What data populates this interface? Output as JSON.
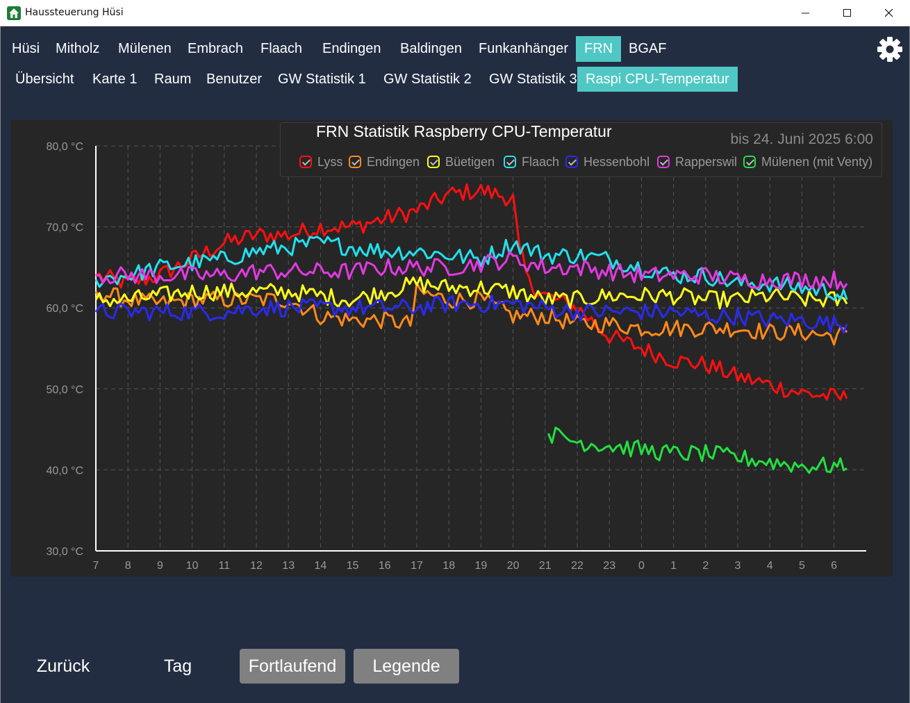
{
  "window": {
    "title": "Haussteuerung Hüsi"
  },
  "nav_top": [
    "Hüsi",
    "Mitholz",
    "Mülenen",
    "Embrach",
    "Flaach",
    "Endingen",
    "Baldingen",
    "Funkanhänger",
    "FRN",
    "BGAF"
  ],
  "nav_top_active": "FRN",
  "nav_sub": [
    "Übersicht",
    "Karte 1",
    "Raum",
    "Benutzer",
    "GW Statistik 1",
    "GW Statistik 2",
    "GW Statistik 3",
    "Raspi CPU-Temperatur"
  ],
  "nav_sub_active": "Raspi CPU-Temperatur",
  "chart_header": {
    "title": "FRN Statistik Raspberry CPU-Temperatur",
    "date": "bis 24. Juni 2025 6:00"
  },
  "bottom": {
    "back": "Zurück",
    "day": "Tag",
    "continuous": "Fortlaufend",
    "legend": "Legende"
  },
  "chart_data": {
    "type": "line",
    "title": "FRN Statistik Raspberry CPU-Temperatur",
    "ylim": [
      30,
      80
    ],
    "yticks": [
      "30,0 °C",
      "40,0 °C",
      "50,0 °C",
      "60,0 °C",
      "70,0 °C",
      "80,0 °C"
    ],
    "xticks": [
      "7",
      "8",
      "9",
      "10",
      "11",
      "12",
      "13",
      "14",
      "15",
      "16",
      "17",
      "18",
      "19",
      "20",
      "21",
      "22",
      "23",
      "0",
      "1",
      "2",
      "3",
      "4",
      "5",
      "6"
    ],
    "xlim": [
      7,
      31
    ],
    "grid": true,
    "legend_position": "top",
    "series": [
      {
        "name": "Lyss",
        "color": "#ff1010",
        "points": [
          [
            7,
            64
          ],
          [
            8,
            63
          ],
          [
            9,
            64
          ],
          [
            10,
            66
          ],
          [
            11,
            68
          ],
          [
            12,
            69
          ],
          [
            13,
            69
          ],
          [
            14,
            70
          ],
          [
            15,
            70
          ],
          [
            16,
            71
          ],
          [
            17,
            72
          ],
          [
            18,
            74
          ],
          [
            19,
            74.5
          ],
          [
            20,
            73.5
          ],
          [
            20.2,
            67
          ],
          [
            20.5,
            63
          ],
          [
            21,
            61.5
          ],
          [
            22,
            60
          ],
          [
            23,
            56.5
          ],
          [
            24,
            55
          ],
          [
            25,
            53.5
          ],
          [
            26,
            53
          ],
          [
            27,
            51.5
          ],
          [
            28,
            50.5
          ],
          [
            29,
            49.5
          ],
          [
            30,
            49
          ],
          [
            30.4,
            48.8
          ]
        ]
      },
      {
        "name": "Endingen",
        "color": "#ff8a1a",
        "points": [
          [
            7,
            62
          ],
          [
            8,
            61
          ],
          [
            9,
            60.5
          ],
          [
            10,
            61
          ],
          [
            11,
            61
          ],
          [
            12,
            61
          ],
          [
            13,
            61
          ],
          [
            14,
            59
          ],
          [
            15,
            58.5
          ],
          [
            16,
            58.5
          ],
          [
            16.8,
            58
          ],
          [
            17,
            62
          ],
          [
            18,
            61
          ],
          [
            19,
            61
          ],
          [
            20,
            59
          ],
          [
            21,
            59
          ],
          [
            22,
            58
          ],
          [
            23,
            58
          ],
          [
            24,
            57.5
          ],
          [
            25,
            57.5
          ],
          [
            26,
            57.5
          ],
          [
            27,
            57.5
          ],
          [
            28,
            57
          ],
          [
            29,
            57
          ],
          [
            30,
            56.5
          ],
          [
            30.4,
            57
          ]
        ]
      },
      {
        "name": "Büetigen",
        "color": "#ffff1a",
        "points": [
          [
            7,
            61
          ],
          [
            8,
            61
          ],
          [
            9,
            61.5
          ],
          [
            10,
            62
          ],
          [
            11,
            62
          ],
          [
            12,
            62
          ],
          [
            13,
            62
          ],
          [
            14,
            61.5
          ],
          [
            15,
            61
          ],
          [
            16,
            62
          ],
          [
            17,
            63
          ],
          [
            18,
            62.5
          ],
          [
            19,
            62.5
          ],
          [
            20,
            62
          ],
          [
            21,
            61
          ],
          [
            22,
            61
          ],
          [
            23,
            61.5
          ],
          [
            24,
            61.5
          ],
          [
            25,
            61.5
          ],
          [
            26,
            61
          ],
          [
            27,
            61
          ],
          [
            28,
            61.5
          ],
          [
            29,
            61
          ],
          [
            30,
            61
          ],
          [
            30.4,
            60.5
          ]
        ]
      },
      {
        "name": "Flaach",
        "color": "#22e0ee",
        "points": [
          [
            7,
            63.5
          ],
          [
            8,
            64
          ],
          [
            9,
            65
          ],
          [
            10,
            65.5
          ],
          [
            11,
            66
          ],
          [
            12,
            67
          ],
          [
            13,
            67.5
          ],
          [
            14,
            68
          ],
          [
            15,
            67.5
          ],
          [
            16,
            67
          ],
          [
            17,
            67
          ],
          [
            18,
            66.5
          ],
          [
            19,
            66
          ],
          [
            20,
            68
          ],
          [
            21,
            66.5
          ],
          [
            22,
            66.5
          ],
          [
            23,
            66
          ],
          [
            24,
            65
          ],
          [
            25,
            64
          ],
          [
            26,
            64
          ],
          [
            27,
            63
          ],
          [
            28,
            63
          ],
          [
            29,
            62.5
          ],
          [
            30,
            62
          ],
          [
            30.4,
            61
          ]
        ]
      },
      {
        "name": "Hessenbohl",
        "color": "#2a2aee",
        "points": [
          [
            7,
            59.5
          ],
          [
            8,
            59.5
          ],
          [
            9,
            59.5
          ],
          [
            10,
            59.5
          ],
          [
            11,
            59.5
          ],
          [
            12,
            60
          ],
          [
            13,
            60
          ],
          [
            14,
            60
          ],
          [
            15,
            60
          ],
          [
            16,
            60
          ],
          [
            17,
            60
          ],
          [
            18,
            60.5
          ],
          [
            19,
            60.5
          ],
          [
            20,
            60.5
          ],
          [
            21,
            60
          ],
          [
            22,
            59.5
          ],
          [
            23,
            59.5
          ],
          [
            24,
            59.5
          ],
          [
            25,
            59.5
          ],
          [
            26,
            59
          ],
          [
            27,
            59
          ],
          [
            28,
            58.5
          ],
          [
            29,
            58.5
          ],
          [
            30,
            58
          ],
          [
            30.4,
            58
          ]
        ]
      },
      {
        "name": "Rapperswil",
        "color": "#e23ae2",
        "points": [
          [
            7,
            64
          ],
          [
            8,
            64
          ],
          [
            9,
            64
          ],
          [
            10,
            64
          ],
          [
            11,
            64
          ],
          [
            12,
            64.5
          ],
          [
            13,
            64.5
          ],
          [
            14,
            64.5
          ],
          [
            15,
            64.5
          ],
          [
            16,
            65
          ],
          [
            17,
            65
          ],
          [
            18,
            65
          ],
          [
            19,
            65.5
          ],
          [
            20,
            66
          ],
          [
            21,
            65
          ],
          [
            22,
            65
          ],
          [
            23,
            64.5
          ],
          [
            24,
            64
          ],
          [
            25,
            64
          ],
          [
            26,
            64
          ],
          [
            27,
            63.5
          ],
          [
            28,
            63.5
          ],
          [
            29,
            63.5
          ],
          [
            30,
            63.5
          ],
          [
            30.4,
            63
          ]
        ]
      },
      {
        "name": "Mülenen (mit Venty)",
        "color": "#22e040",
        "points": [
          [
            21.1,
            44.5
          ],
          [
            22,
            43.5
          ],
          [
            23,
            43
          ],
          [
            24,
            42.5
          ],
          [
            25,
            42
          ],
          [
            26,
            42
          ],
          [
            27,
            41.5
          ],
          [
            28,
            41
          ],
          [
            29,
            40.5
          ],
          [
            30,
            40.5
          ],
          [
            30.4,
            40.2
          ]
        ]
      }
    ]
  }
}
